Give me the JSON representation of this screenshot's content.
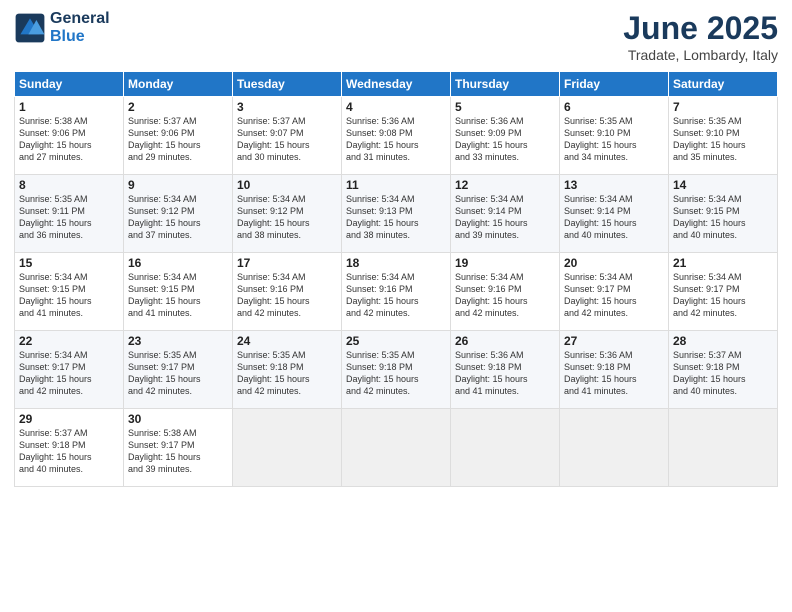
{
  "header": {
    "logo_line1": "General",
    "logo_line2": "Blue",
    "title": "June 2025",
    "subtitle": "Tradate, Lombardy, Italy"
  },
  "weekdays": [
    "Sunday",
    "Monday",
    "Tuesday",
    "Wednesday",
    "Thursday",
    "Friday",
    "Saturday"
  ],
  "weeks": [
    [
      {
        "day": "1",
        "lines": [
          "Sunrise: 5:38 AM",
          "Sunset: 9:06 PM",
          "Daylight: 15 hours",
          "and 27 minutes."
        ]
      },
      {
        "day": "2",
        "lines": [
          "Sunrise: 5:37 AM",
          "Sunset: 9:06 PM",
          "Daylight: 15 hours",
          "and 29 minutes."
        ]
      },
      {
        "day": "3",
        "lines": [
          "Sunrise: 5:37 AM",
          "Sunset: 9:07 PM",
          "Daylight: 15 hours",
          "and 30 minutes."
        ]
      },
      {
        "day": "4",
        "lines": [
          "Sunrise: 5:36 AM",
          "Sunset: 9:08 PM",
          "Daylight: 15 hours",
          "and 31 minutes."
        ]
      },
      {
        "day": "5",
        "lines": [
          "Sunrise: 5:36 AM",
          "Sunset: 9:09 PM",
          "Daylight: 15 hours",
          "and 33 minutes."
        ]
      },
      {
        "day": "6",
        "lines": [
          "Sunrise: 5:35 AM",
          "Sunset: 9:10 PM",
          "Daylight: 15 hours",
          "and 34 minutes."
        ]
      },
      {
        "day": "7",
        "lines": [
          "Sunrise: 5:35 AM",
          "Sunset: 9:10 PM",
          "Daylight: 15 hours",
          "and 35 minutes."
        ]
      }
    ],
    [
      {
        "day": "8",
        "lines": [
          "Sunrise: 5:35 AM",
          "Sunset: 9:11 PM",
          "Daylight: 15 hours",
          "and 36 minutes."
        ]
      },
      {
        "day": "9",
        "lines": [
          "Sunrise: 5:34 AM",
          "Sunset: 9:12 PM",
          "Daylight: 15 hours",
          "and 37 minutes."
        ]
      },
      {
        "day": "10",
        "lines": [
          "Sunrise: 5:34 AM",
          "Sunset: 9:12 PM",
          "Daylight: 15 hours",
          "and 38 minutes."
        ]
      },
      {
        "day": "11",
        "lines": [
          "Sunrise: 5:34 AM",
          "Sunset: 9:13 PM",
          "Daylight: 15 hours",
          "and 38 minutes."
        ]
      },
      {
        "day": "12",
        "lines": [
          "Sunrise: 5:34 AM",
          "Sunset: 9:14 PM",
          "Daylight: 15 hours",
          "and 39 minutes."
        ]
      },
      {
        "day": "13",
        "lines": [
          "Sunrise: 5:34 AM",
          "Sunset: 9:14 PM",
          "Daylight: 15 hours",
          "and 40 minutes."
        ]
      },
      {
        "day": "14",
        "lines": [
          "Sunrise: 5:34 AM",
          "Sunset: 9:15 PM",
          "Daylight: 15 hours",
          "and 40 minutes."
        ]
      }
    ],
    [
      {
        "day": "15",
        "lines": [
          "Sunrise: 5:34 AM",
          "Sunset: 9:15 PM",
          "Daylight: 15 hours",
          "and 41 minutes."
        ]
      },
      {
        "day": "16",
        "lines": [
          "Sunrise: 5:34 AM",
          "Sunset: 9:15 PM",
          "Daylight: 15 hours",
          "and 41 minutes."
        ]
      },
      {
        "day": "17",
        "lines": [
          "Sunrise: 5:34 AM",
          "Sunset: 9:16 PM",
          "Daylight: 15 hours",
          "and 42 minutes."
        ]
      },
      {
        "day": "18",
        "lines": [
          "Sunrise: 5:34 AM",
          "Sunset: 9:16 PM",
          "Daylight: 15 hours",
          "and 42 minutes."
        ]
      },
      {
        "day": "19",
        "lines": [
          "Sunrise: 5:34 AM",
          "Sunset: 9:16 PM",
          "Daylight: 15 hours",
          "and 42 minutes."
        ]
      },
      {
        "day": "20",
        "lines": [
          "Sunrise: 5:34 AM",
          "Sunset: 9:17 PM",
          "Daylight: 15 hours",
          "and 42 minutes."
        ]
      },
      {
        "day": "21",
        "lines": [
          "Sunrise: 5:34 AM",
          "Sunset: 9:17 PM",
          "Daylight: 15 hours",
          "and 42 minutes."
        ]
      }
    ],
    [
      {
        "day": "22",
        "lines": [
          "Sunrise: 5:34 AM",
          "Sunset: 9:17 PM",
          "Daylight: 15 hours",
          "and 42 minutes."
        ]
      },
      {
        "day": "23",
        "lines": [
          "Sunrise: 5:35 AM",
          "Sunset: 9:17 PM",
          "Daylight: 15 hours",
          "and 42 minutes."
        ]
      },
      {
        "day": "24",
        "lines": [
          "Sunrise: 5:35 AM",
          "Sunset: 9:18 PM",
          "Daylight: 15 hours",
          "and 42 minutes."
        ]
      },
      {
        "day": "25",
        "lines": [
          "Sunrise: 5:35 AM",
          "Sunset: 9:18 PM",
          "Daylight: 15 hours",
          "and 42 minutes."
        ]
      },
      {
        "day": "26",
        "lines": [
          "Sunrise: 5:36 AM",
          "Sunset: 9:18 PM",
          "Daylight: 15 hours",
          "and 41 minutes."
        ]
      },
      {
        "day": "27",
        "lines": [
          "Sunrise: 5:36 AM",
          "Sunset: 9:18 PM",
          "Daylight: 15 hours",
          "and 41 minutes."
        ]
      },
      {
        "day": "28",
        "lines": [
          "Sunrise: 5:37 AM",
          "Sunset: 9:18 PM",
          "Daylight: 15 hours",
          "and 40 minutes."
        ]
      }
    ],
    [
      {
        "day": "29",
        "lines": [
          "Sunrise: 5:37 AM",
          "Sunset: 9:18 PM",
          "Daylight: 15 hours",
          "and 40 minutes."
        ]
      },
      {
        "day": "30",
        "lines": [
          "Sunrise: 5:38 AM",
          "Sunset: 9:17 PM",
          "Daylight: 15 hours",
          "and 39 minutes."
        ]
      },
      {
        "day": "",
        "lines": []
      },
      {
        "day": "",
        "lines": []
      },
      {
        "day": "",
        "lines": []
      },
      {
        "day": "",
        "lines": []
      },
      {
        "day": "",
        "lines": []
      }
    ]
  ]
}
